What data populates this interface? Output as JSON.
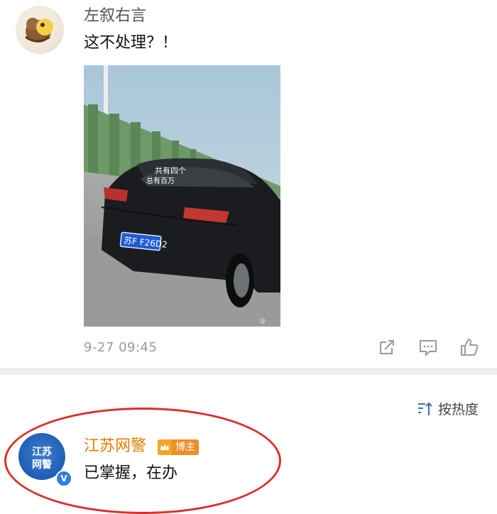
{
  "comment1": {
    "username": "左叙右言",
    "text": "这不处理？！",
    "photo": {
      "plate": "苏F F26D2",
      "rear_sticker_top": "共有四个",
      "rear_sticker_bottom": "总有百万",
      "watermark": "@"
    },
    "timestamp": "9-27 09:45"
  },
  "sort": {
    "label": "按热度"
  },
  "comment2": {
    "username": "江苏网警",
    "badge": "博主",
    "text": "已掌握，在办",
    "avatar_line1": "江苏",
    "avatar_line2": "网警",
    "verified_mark": "V"
  },
  "colors": {
    "username2": "#e37e00",
    "highlight_circle": "#d8312a",
    "badge_bg": "#f08c28"
  }
}
